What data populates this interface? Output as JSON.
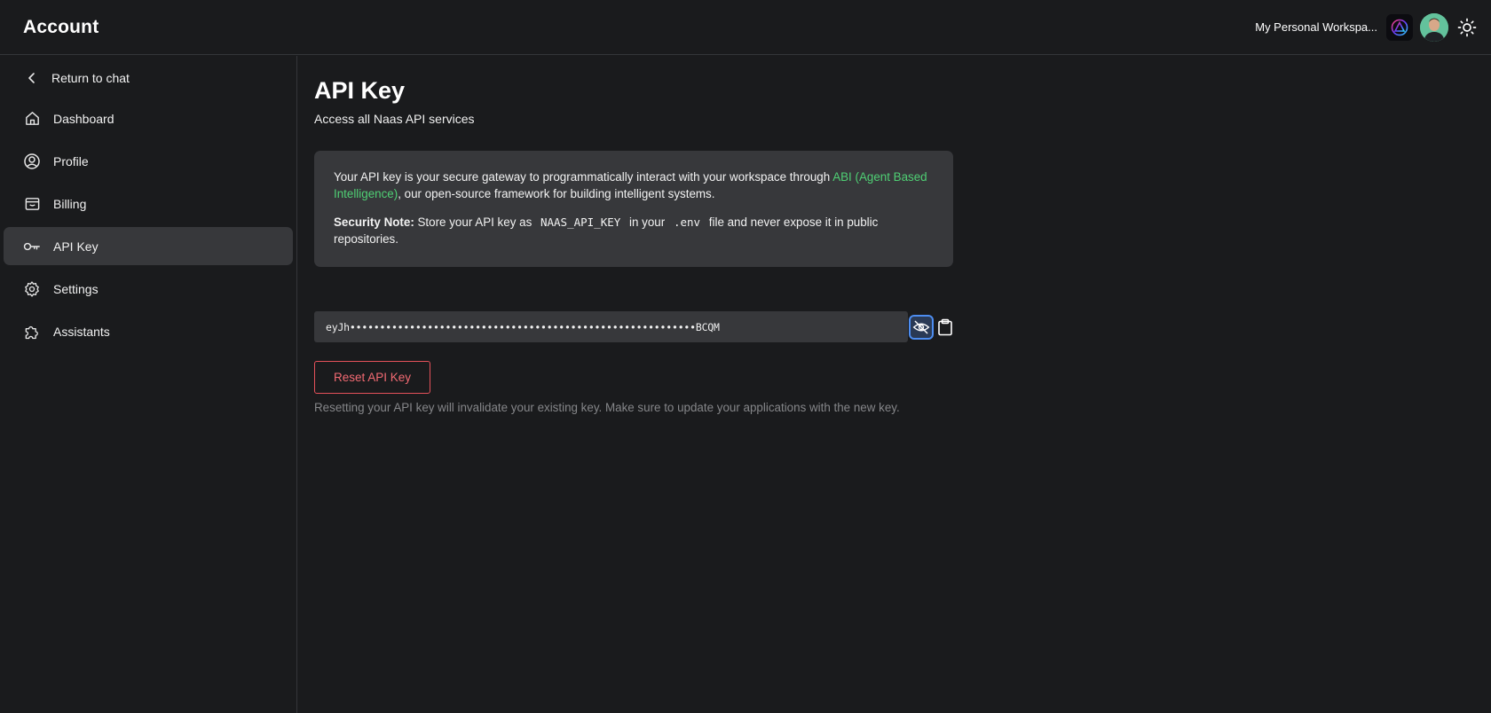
{
  "header": {
    "title": "Account",
    "workspace_name": "My Personal Workspa...",
    "workspace_logo_icon": "triangle-logo-icon",
    "avatar_icon": "user-avatar",
    "theme_toggle_icon": "sun-icon"
  },
  "sidebar": {
    "return_label": "Return to chat",
    "items": [
      {
        "label": "Dashboard",
        "icon": "home-icon"
      },
      {
        "label": "Profile",
        "icon": "user-circle-icon"
      },
      {
        "label": "Billing",
        "icon": "wallet-icon"
      },
      {
        "label": "API Key",
        "icon": "key-icon",
        "active": true
      },
      {
        "label": "Settings",
        "icon": "gear-icon"
      },
      {
        "label": "Assistants",
        "icon": "puzzle-icon"
      }
    ]
  },
  "main": {
    "title": "API Key",
    "subtitle": "Access all Naas API services",
    "info": {
      "p1_before": "Your API key is your secure gateway to programmatically interact with your workspace through ",
      "p1_link": "ABI (Agent Based Intelligence)",
      "p1_after": ", our open-source framework for building intelligent systems.",
      "p2_label": "Security Note:",
      "p2_text1": " Store your API key as ",
      "p2_code1": "NAAS_API_KEY",
      "p2_text2": " in your ",
      "p2_code2": ".env",
      "p2_text3": " file and never expose it in public repositories."
    },
    "api_key_masked": "eyJh••••••••••••••••••••••••••••••••••••••••••••••••••••••••••BCQM",
    "toggle_visibility_icon": "eye-off-icon",
    "copy_icon": "clipboard-icon",
    "reset_button_label": "Reset API Key",
    "reset_note": "Resetting your API key will invalidate your existing key. Make sure to update your applications with the new key."
  },
  "colors": {
    "background": "#1a1b1d",
    "card": "#37383b",
    "accent_link": "#4fcf74",
    "danger": "#e4515a",
    "muted": "#858689"
  }
}
